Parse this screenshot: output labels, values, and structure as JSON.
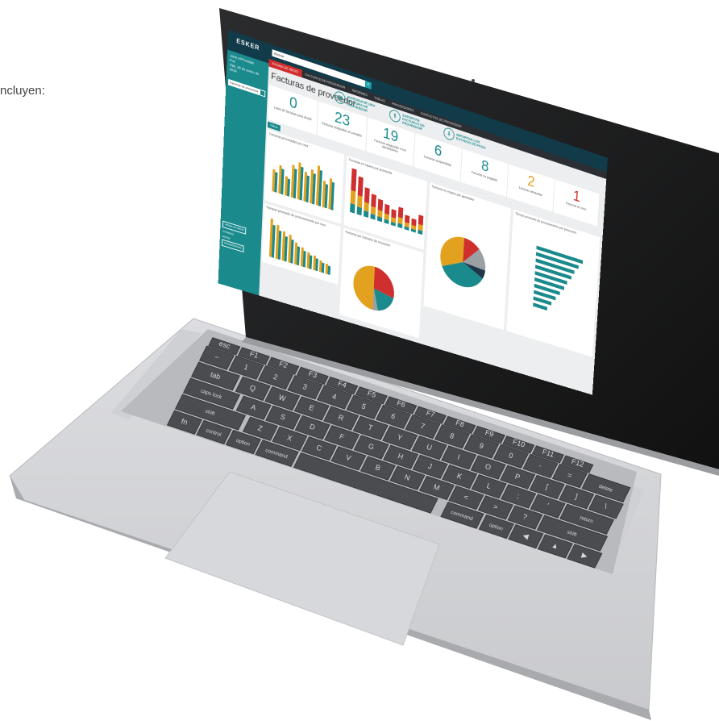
{
  "side_text": "ncluyen:",
  "app": {
    "logo": "ESKER",
    "user_lines": [
      "Jane APProvider",
      "Fox",
      "Ojai, 28 de enero de 2019"
    ],
    "sidebar_select": "Facturas de proveedor",
    "sidebar_bottom": [
      "Ventas de cliente",
      "Contactos",
      "Alertas",
      "Actualizaciones"
    ],
    "search_placeholder": "Buscar",
    "nav": [
      "PÁGINA DE INICIO",
      "FACTURAS DE PROVEEDOR",
      "INFORMES",
      "TABLAS",
      "PROVEEDORES",
      "CONTACTOS DE PROVEEDOR"
    ],
    "page_title": "Facturas de proveedor",
    "actions": [
      {
        "label": "INTRODUCIR UNA FACTURA DE PROVEEDOR",
        "icon": "invoice-icon"
      },
      {
        "label": "EXPORTAR FACTURAS DE PROVEEDOR",
        "icon": "export-icon"
      },
      {
        "label": "IMPORTAR LOS ESTADOS DE PAGO",
        "icon": "import-icon"
      }
    ],
    "kpis": [
      {
        "value": "0",
        "label": "Lotes de facturas para dividir",
        "color": "#1a8a8d"
      },
      {
        "value": "23",
        "label": "Facturas asignadas al contable",
        "color": "#1a8a8d"
      },
      {
        "value": "19",
        "label": "Facturas asignadas a los aprobadores",
        "color": "#1a8a8d"
      },
      {
        "value": "6",
        "label": "Facturas suspendidas",
        "color": "#1a8a8d"
      },
      {
        "value": "8",
        "label": "Facturas no pagadas",
        "color": "#1a8a8d"
      },
      {
        "value": "2",
        "label": "Facturas atrasadas",
        "color": "#e79b1d"
      },
      {
        "value": "1",
        "label": "Facturas en error",
        "color": "#d12d2d"
      }
    ],
    "filter_tab": "Filtros",
    "panels": {
      "p1": "Facturas procesadas por mes",
      "p2": "Facturas en espera por proveedor",
      "p3": "Facturas en espera por aprobador",
      "p4": "Tiempo promedio de procesamiento por proveedor",
      "p5": "Tiempos promedio de procesamiento por mes",
      "p6": "Facturas por métodos de recepción"
    },
    "colors": {
      "teal": "#1a8a8d",
      "orange": "#e2a21f",
      "red": "#cf2f2f",
      "gray": "#9aa0a4",
      "navy": "#123b4a"
    }
  },
  "keyboard": {
    "row1": [
      "esc",
      "F1",
      "F2",
      "F3",
      "F4",
      "F5",
      "F6",
      "F7",
      "F8",
      "F9",
      "F10",
      "F11",
      "F12"
    ],
    "row2": [
      "~",
      "1",
      "2",
      "3",
      "4",
      "5",
      "6",
      "7",
      "8",
      "9",
      "0",
      "-",
      "=",
      "delete"
    ],
    "row3": [
      "tab",
      "Q",
      "W",
      "E",
      "R",
      "T",
      "Y",
      "U",
      "I",
      "O",
      "P",
      "[",
      "]",
      "\\"
    ],
    "row4": [
      "caps lock",
      "A",
      "S",
      "D",
      "F",
      "G",
      "H",
      "J",
      "K",
      "L",
      ";",
      "'",
      "return"
    ],
    "row5": [
      "shift",
      "Z",
      "X",
      "C",
      "V",
      "B",
      "N",
      "M",
      "<",
      ">",
      "?",
      "shift"
    ],
    "row6": [
      "fn",
      "control",
      "option",
      "command",
      "",
      "command",
      "option",
      "◀",
      "▲",
      "▶"
    ]
  }
}
